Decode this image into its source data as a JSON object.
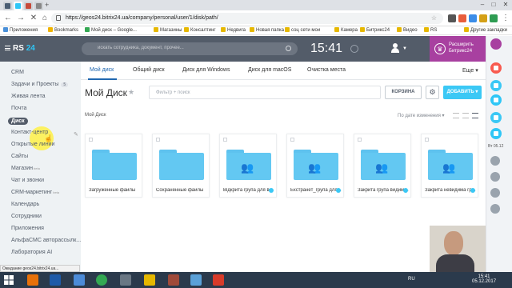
{
  "browser": {
    "url": "https://geos24.bitrix24.ua/company/personal/user/1/disk/path/",
    "bookmarks": [
      "Приложения",
      "Bookmarks",
      "Мой диск – Google...",
      "Магазины",
      "Консалтинг",
      "Недвига",
      "Новая папка",
      "соц сети мои",
      "Камера",
      "Битрикс24",
      "Видео",
      "RS",
      "Другие закладки"
    ]
  },
  "header": {
    "logo_left": "RS",
    "logo_right": "24",
    "search_placeholder": "искать сотрудника, документ, прочее...",
    "clock": "15:41",
    "upgrade_line1": "Расширить",
    "upgrade_line2": "Битрикс24"
  },
  "sidebar": {
    "items": [
      {
        "label": "CRM",
        "count": ""
      },
      {
        "label": "Задачи и Проекты",
        "count": "5"
      },
      {
        "label": "Живая лента",
        "count": ""
      },
      {
        "label": "Почта",
        "count": ""
      },
      {
        "label": "Диск",
        "count": ""
      },
      {
        "label": "Контакт-центр",
        "count": ""
      },
      {
        "label": "Открытые линии",
        "count": ""
      },
      {
        "label": "Сайты",
        "count": ""
      },
      {
        "label": "Магазин",
        "count": "beta"
      },
      {
        "label": "Чат и звонки",
        "count": ""
      },
      {
        "label": "CRM-маркетинг",
        "count": "beta"
      },
      {
        "label": "Календарь",
        "count": ""
      },
      {
        "label": "Сотрудники",
        "count": ""
      },
      {
        "label": "Приложения",
        "count": ""
      },
      {
        "label": "АльфаСМС авторассылк...",
        "count": ""
      },
      {
        "label": "Лаборатория AI",
        "count": ""
      }
    ]
  },
  "disk": {
    "tabs": [
      "Мой диск",
      "Общий диск",
      "Диск для Windows",
      "Диск для macOS",
      "Очистка места"
    ],
    "more": "Еще",
    "title": "Мой Диск",
    "filter_placeholder": "Фильтр + поиск",
    "trash_label": "КОРЗИНА",
    "add_label": "ДОБАВИТЬ",
    "breadcrumb": "Мой Диск",
    "sort_label": "По дате изменения",
    "folders": [
      {
        "name": "Загруженные файлы",
        "shared": false
      },
      {
        "name": "Сохраненные файлы",
        "shared": false
      },
      {
        "name": "Відкрита група для в...",
        "shared": true
      },
      {
        "name": "Екстранет_група для...",
        "shared": true
      },
      {
        "name": "Закрита група видима...",
        "shared": true
      },
      {
        "name": "Закрита невидима гр...",
        "shared": true
      }
    ]
  },
  "status_bar": "Ожидание geos24.bitrix24.ua...",
  "rail": {
    "date": "Вт 05.12"
  },
  "taskbar": {
    "lang": "RU",
    "time": "15:41",
    "date": "05.12.2017"
  },
  "colors": {
    "header": "#535c69",
    "accent": "#2fc6f6",
    "upgrade": "#a840a0",
    "folder": "#63c8f2"
  }
}
